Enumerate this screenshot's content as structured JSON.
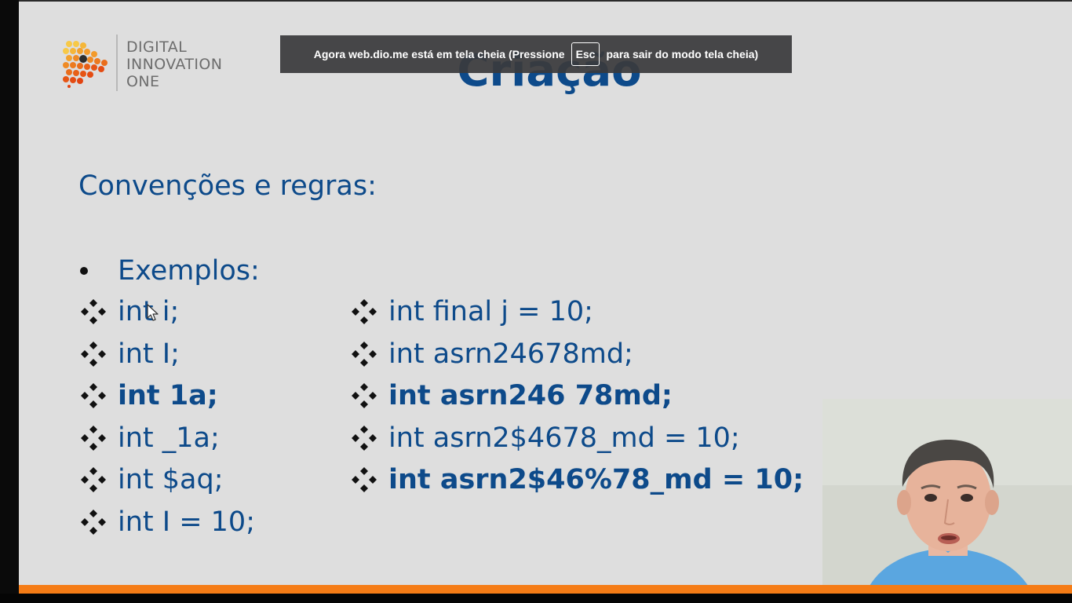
{
  "fullscreen_notice": {
    "text_before": "Agora web.dio.me está em tela cheia (Pressione",
    "key": "Esc",
    "text_after": "para sair do modo tela cheia)"
  },
  "logo": {
    "line1": "DIGITAL",
    "line2": "INNOVATION",
    "line3": "ONE"
  },
  "slide": {
    "title": "Criação",
    "subtitle": "Convenções e regras:",
    "bullet": "Exemplos:",
    "examples_left": [
      {
        "text": "int i;",
        "bold": false
      },
      {
        "text": "int I;",
        "bold": false
      },
      {
        "text": "int 1a;",
        "bold": true
      },
      {
        "text": "int _1a;",
        "bold": false
      },
      {
        "text": "int $aq;",
        "bold": false
      },
      {
        "text": "int I = 10;",
        "bold": false
      }
    ],
    "examples_right": [
      {
        "text": "int final j = 10;",
        "bold": false
      },
      {
        "text": "int asrn24678md;",
        "bold": false
      },
      {
        "text": "int asrn246 78md;",
        "bold": true
      },
      {
        "text": "int asrn2$4678_md = 10;",
        "bold": false
      },
      {
        "text": "int asrn2$46%78_md = 10;",
        "bold": true
      }
    ]
  },
  "colors": {
    "slide_text": "#0d4a8a",
    "accent_bar": "#f57c16",
    "slide_background": "#dedede"
  }
}
